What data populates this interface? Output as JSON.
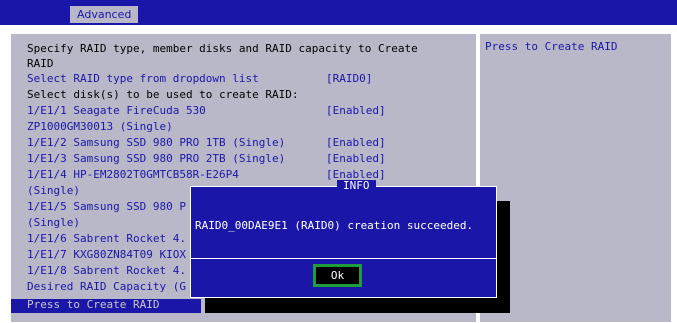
{
  "menu": {
    "active_tab": "Advanced"
  },
  "help_text": "Press to Create RAID",
  "rows": [
    {
      "label": "Specify RAID type, member disks and RAID capacity to Create",
      "value": ""
    },
    {
      "label": "RAID",
      "value": ""
    },
    {
      "label": "Select RAID type from dropdown list",
      "value": "[RAID0]"
    },
    {
      "label": "Select disk(s) to be used to create RAID:",
      "value": ""
    },
    {
      "label": "1/E1/1 Seagate FireCuda 530",
      "value": "[Enabled]"
    },
    {
      "label": "ZP1000GM30013 (Single)",
      "value": ""
    },
    {
      "label": "1/E1/2 Samsung SSD 980 PRO 1TB (Single)",
      "value": "[Enabled]"
    },
    {
      "label": "1/E1/3 Samsung SSD 980 PRO 2TB (Single)",
      "value": "[Enabled]"
    },
    {
      "label": "1/E1/4 HP-EM2802T0GMTCB58R-E26P4",
      "value": "[Enabled]"
    },
    {
      "label": "(Single)",
      "value": ""
    },
    {
      "label": "1/E1/5 Samsung SSD 980 P",
      "value": ""
    },
    {
      "label": "(Single)",
      "value": ""
    },
    {
      "label": "1/E1/6 Sabrent Rocket 4.",
      "value": ""
    },
    {
      "label": "1/E1/7 KXG80ZN84T09 KIOX",
      "value": ""
    },
    {
      "label": "1/E1/8 Sabrent Rocket 4.",
      "value": ""
    },
    {
      "label": "Desired RAID Capacity (G",
      "value": ""
    },
    {
      "label": "Press to Create RAID",
      "value": ""
    }
  ],
  "dialog": {
    "title": "INFO",
    "message": "RAID0_00DAE9E1 (RAID0) creation succeeded.",
    "ok_label": "Ok"
  },
  "colors": {
    "bios_blue": "#1a17a8",
    "panel_gray": "#b8b8c8",
    "focus_green": "#1e9d3c"
  }
}
